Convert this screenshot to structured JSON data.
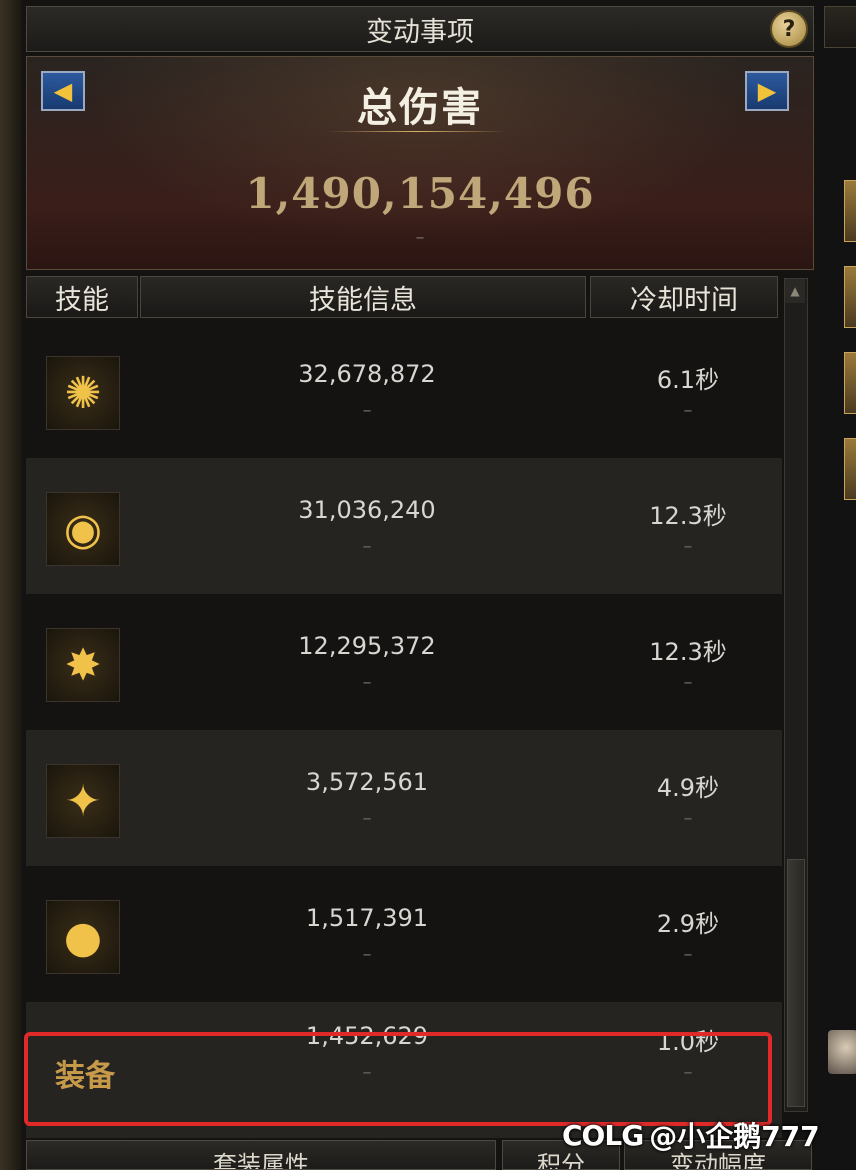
{
  "window": {
    "title": "变动事项",
    "help_label": "?"
  },
  "banner": {
    "prev_arrow": "◀",
    "next_arrow": "▶",
    "title": "总伤害",
    "total_value": "1,490,154,496",
    "sub_value": "–"
  },
  "table": {
    "headers": [
      "技能",
      "技能信息",
      "冷却时间"
    ],
    "rows": [
      {
        "icon": "rays-icon",
        "icon_glyph": "✺",
        "value": "32,678,872",
        "cooldown": "6.1秒",
        "value_sub": "–",
        "cooldown_sub": "–"
      },
      {
        "icon": "disc-icon",
        "icon_glyph": "◉",
        "value": "31,036,240",
        "cooldown": "12.3秒",
        "value_sub": "–",
        "cooldown_sub": "–"
      },
      {
        "icon": "grenade-burst-icon",
        "icon_glyph": "✸",
        "value": "12,295,372",
        "cooldown": "12.3秒",
        "value_sub": "–",
        "cooldown_sub": "–"
      },
      {
        "icon": "grenade-spark-icon",
        "icon_glyph": "✦",
        "value": "3,572,561",
        "cooldown": "4.9秒",
        "value_sub": "–",
        "cooldown_sub": "–"
      },
      {
        "icon": "grenade-icon",
        "icon_glyph": "●",
        "value": "1,517,391",
        "cooldown": "2.9秒",
        "value_sub": "–",
        "cooldown_sub": "–"
      },
      {
        "icon": "equipment-label",
        "icon_glyph": "装备",
        "value": "1,452,629",
        "cooldown": "1.0秒",
        "value_sub": "–",
        "cooldown_sub": "–"
      }
    ]
  },
  "bottom_tabs": [
    "套装属性",
    "积分",
    "变动幅度"
  ],
  "scroll": {
    "up_glyph": "▲"
  },
  "watermark": {
    "logo": "COLG",
    "text": "@小企鹅777"
  },
  "colors": {
    "highlight": "#e02a2a",
    "gold": "#f0c24a",
    "banner_value": "#bfa77a"
  }
}
